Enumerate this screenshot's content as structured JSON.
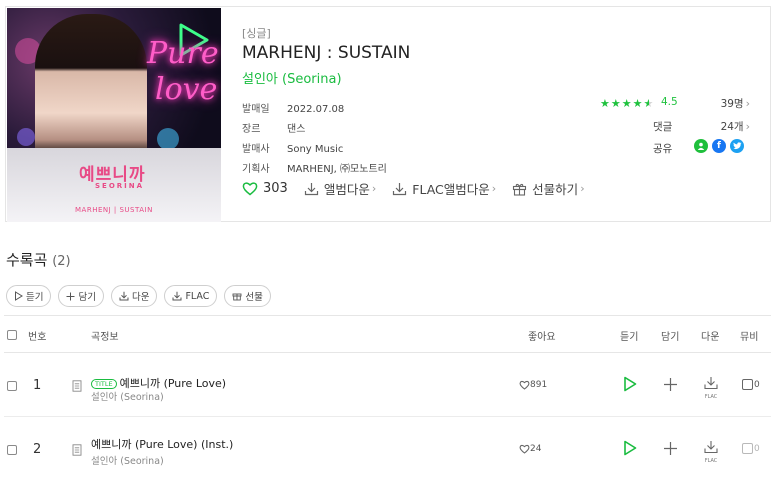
{
  "album": {
    "type_tag": "[싱글]",
    "title": "MARHENJ : SUSTAIN",
    "artist": "설인아 (Seorina)",
    "cover": {
      "korean_title": "예쁘니까",
      "english_name": "SEORINA",
      "neon_line1": "Pure",
      "neon_line2": "love",
      "bottom_text": "MARHENJ | SUSTAIN"
    },
    "meta": [
      {
        "key": "발매일",
        "value": "2022.07.08"
      },
      {
        "key": "장르",
        "value": "댄스"
      },
      {
        "key": "발매사",
        "value": "Sony Music"
      },
      {
        "key": "기획사",
        "value": "MARHENJ, ㈜모노트리"
      }
    ],
    "rating_value": "4.5",
    "rating_count": "39명",
    "comments_label": "댓글",
    "comments_count": "24개",
    "share_label": "공유",
    "likes": "303",
    "actions": {
      "download": "앨범다운",
      "flac_download": "FLAC앨범다운",
      "gift": "선물하기"
    },
    "colors": {
      "accent": "#1abc40",
      "star": "#1fc23e",
      "facebook": "#1877f2",
      "twitter": "#1da1f2",
      "kakao_green": "#1fbf3c"
    }
  },
  "tracklist": {
    "title": "수록곡",
    "count": "(2)",
    "buttons": {
      "listen": "듣기",
      "add": "담기",
      "download": "다운",
      "flac": "FLAC",
      "gift": "선물"
    },
    "headers": {
      "number": "번호",
      "info": "곡정보",
      "likes": "좋아요",
      "listen": "듣기",
      "add": "담기",
      "download": "다운",
      "mv": "뮤비"
    },
    "rows": [
      {
        "num": "1",
        "badge": "TITLE",
        "title": "예쁘니까 (Pure Love)",
        "artist": "설인아 (Seorina)",
        "likes": "891",
        "flac": "FLAC",
        "mv": "0"
      },
      {
        "num": "2",
        "badge": "",
        "title": "예쁘니까 (Pure Love) (Inst.)",
        "artist": "설인아 (Seorina)",
        "likes": "24",
        "flac": "FLAC",
        "mv": "0"
      }
    ]
  }
}
